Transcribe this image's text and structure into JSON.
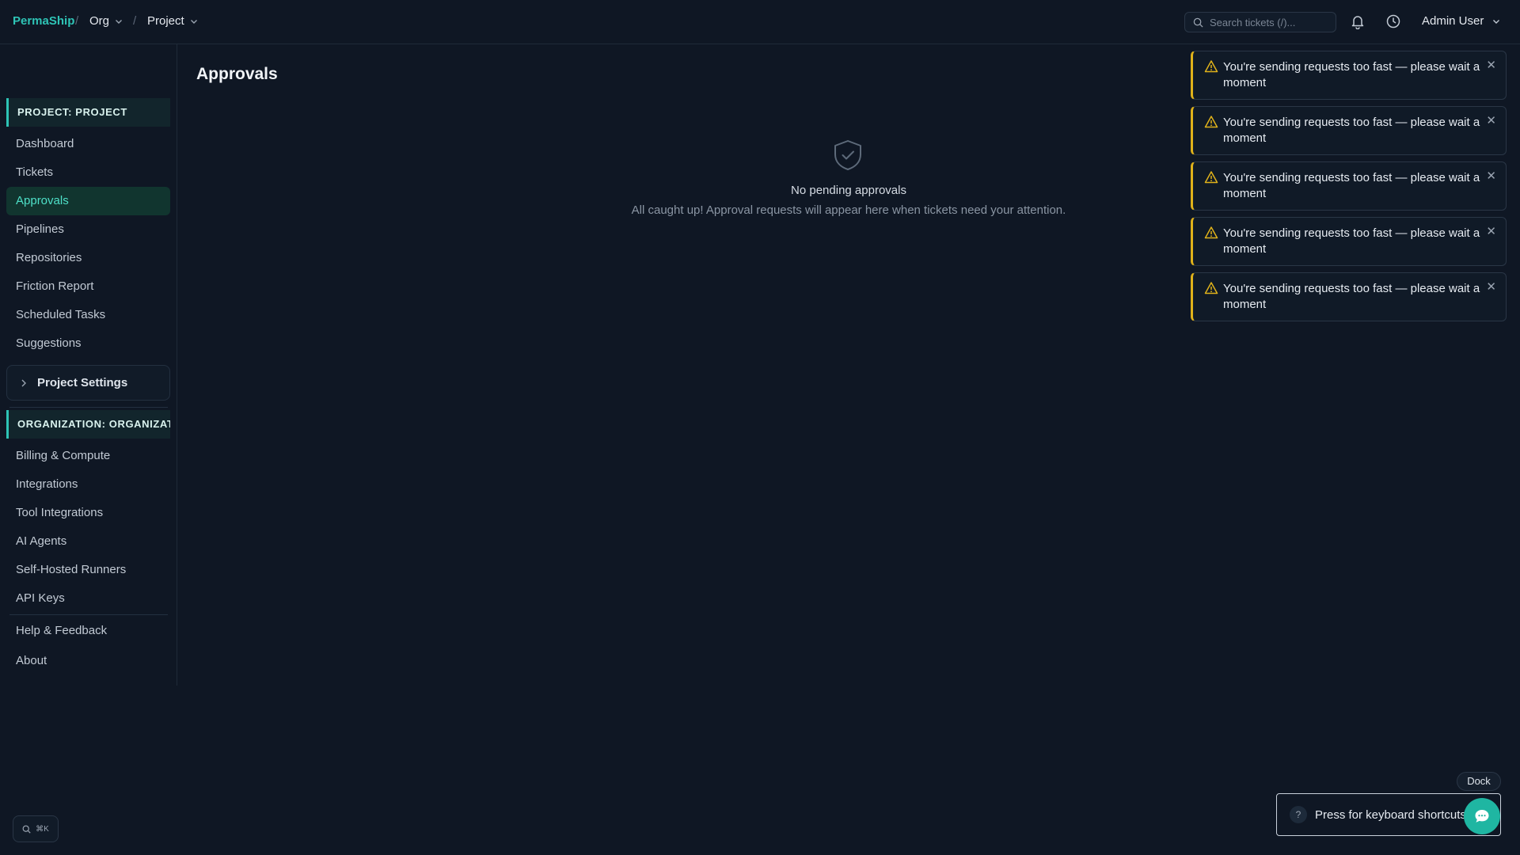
{
  "header": {
    "brand": "PermaShip",
    "separator": "/",
    "org_label": "Org",
    "project_label": "Project",
    "search_placeholder": "Search tickets (/)...",
    "user_label": "Admin User"
  },
  "sidebar": {
    "project_section": "PROJECT: PROJECT",
    "project_items": [
      {
        "label": "Dashboard"
      },
      {
        "label": "Tickets"
      },
      {
        "label": "Approvals",
        "active": true
      },
      {
        "label": "Pipelines"
      },
      {
        "label": "Repositories"
      },
      {
        "label": "Friction Report"
      },
      {
        "label": "Scheduled Tasks"
      },
      {
        "label": "Suggestions"
      }
    ],
    "project_settings": "Project Settings",
    "org_section": "ORGANIZATION: ORGANIZATION",
    "org_items": [
      {
        "label": "Billing & Compute"
      },
      {
        "label": "Integrations"
      },
      {
        "label": "Tool Integrations"
      },
      {
        "label": "AI Agents"
      },
      {
        "label": "Self-Hosted Runners"
      },
      {
        "label": "API Keys"
      }
    ],
    "footer_items": [
      {
        "label": "Help & Feedback"
      },
      {
        "label": "About"
      }
    ]
  },
  "main": {
    "title": "Approvals",
    "empty_title": "No pending approvals",
    "empty_subtitle": "All caught up! Approval requests will appear here when tickets need your attention."
  },
  "toasts": [
    {
      "message": "You're sending requests too fast — please wait a moment"
    },
    {
      "message": "You're sending requests too fast — please wait a moment"
    },
    {
      "message": "You're sending requests too fast — please wait a moment"
    },
    {
      "message": "You're sending requests too fast — please wait a moment"
    },
    {
      "message": "You're sending requests too fast — please wait a moment"
    }
  ],
  "footer": {
    "cmdk_label": "⌘K",
    "dock_label": "Dock",
    "shortcuts_hint": "Press for keyboard shortcuts",
    "shortcut_key": "?"
  },
  "colors": {
    "background": "#0f1724",
    "accent": "#2ec4b6",
    "active_bg": "#11352f",
    "warning": "#e0b21a"
  }
}
